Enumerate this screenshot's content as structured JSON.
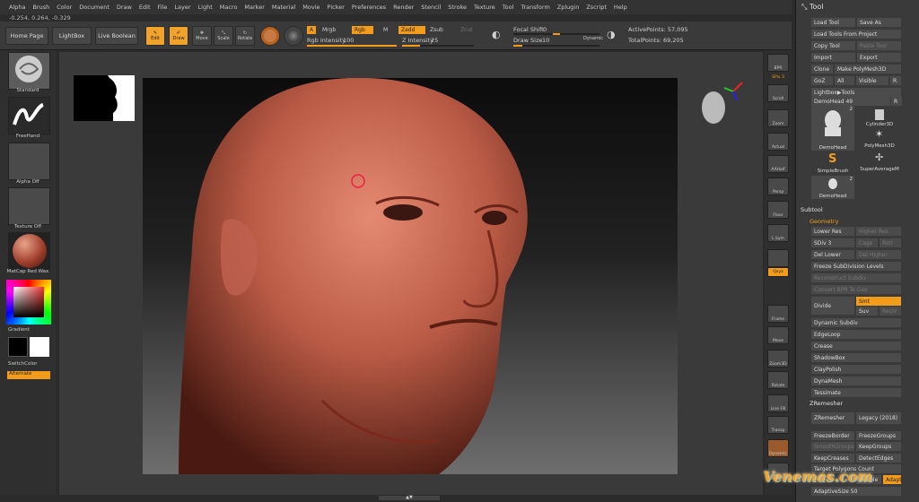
{
  "menu": [
    "Alpha",
    "Brush",
    "Color",
    "Document",
    "Draw",
    "Edit",
    "File",
    "Layer",
    "Light",
    "Macro",
    "Marker",
    "Material",
    "Movie",
    "Picker",
    "Preferences",
    "Render",
    "Stencil",
    "Stroke",
    "Texture",
    "Tool",
    "Transform",
    "Zplugin",
    "Zscript",
    "Help"
  ],
  "coords": "-0.254, 0.264, -0.329",
  "toolbar": {
    "home": "Home Page",
    "lightbox": "LightBox",
    "live_boolean": "Live Boolean",
    "edit": "Edit",
    "draw": "Draw",
    "move": "Move",
    "scale": "Scale",
    "rotate": "Rotate",
    "a": "A",
    "mrgb": "Mrgb",
    "rgb": "Rgb",
    "m": "M",
    "zadd": "Zadd",
    "zsub": "Zsub",
    "zcut": "Zcut",
    "rgb_intensity_label": "Rgb Intensity",
    "rgb_intensity_value": "100",
    "z_intensity_label": "Z Intensity",
    "z_intensity_value": "25",
    "focal_shift_label": "Focal Shift",
    "focal_shift_value": "0",
    "draw_size_label": "Draw Size",
    "draw_size_value": "10",
    "dynamic": "Dynamic",
    "active_points": "ActivePoints: 57,095",
    "total_points": "TotalPoints: 69,205",
    "rgb_intensity_level": 1.0,
    "z_intensity_level": 0.25,
    "draw_size_level": 0.1
  },
  "left": {
    "standard": "Standard",
    "freehand": "FreeHand",
    "alpha_off": "Alpha Off",
    "texture_off": "Texture Off",
    "matcap": "MatCap Red Wax",
    "gradient": "Gradient",
    "switchcolor": "SwitchColor",
    "alternate": "Alternate"
  },
  "right": {
    "bpr": "BPR",
    "spix": "SPix 3",
    "scroll": "Scroll",
    "zoom": "Zoom",
    "actual": "Actual",
    "aahalf": "AAHalf",
    "dynamic": "Dynamic",
    "persp": "Persp",
    "floor": "Floor",
    "lsym": "L.Sym",
    "xyz": "Qxyz",
    "frame": "Frame",
    "move": "Move",
    "zoom3d": "Zoom3D",
    "rotate": "Rotate",
    "line_fill": "Line Fill",
    "polyf": "PolyF",
    "transp": "Transp",
    "dynamic2": "Dynamic",
    "solo": "Solo"
  },
  "palette": {
    "title": "Tool",
    "load_tool": "Load Tool",
    "save_as": "Save As",
    "load_from_project": "Load Tools From Project",
    "copy_tool": "Copy Tool",
    "paste_tool": "Paste Tool",
    "import": "Import",
    "export": "Export",
    "clone": "Clone",
    "make_polymesh": "Make PolyMesh3D",
    "goz": "GoZ",
    "all": "All",
    "visible": "Visible",
    "r": "R",
    "lightbox_tools": "Lightbox▶Tools",
    "current_tool": "DemoHead",
    "current_tool_count": "49",
    "r2": "R",
    "tools": [
      {
        "name": "DemoHead",
        "badge": "2"
      },
      {
        "name": "Cylinder3D",
        "badge": ""
      },
      {
        "name": "SimpleBrush",
        "badge": ""
      },
      {
        "name": "PolyMesh3D",
        "badge": ""
      },
      {
        "name": "SuperAverageM",
        "badge": ""
      },
      {
        "name": "DemoHead",
        "badge": "2"
      }
    ],
    "subtool": "Subtool",
    "geometry": "Geometry",
    "lower_res": "Lower Res",
    "higher_res": "Higher Res",
    "sdiv": "SDiv 3",
    "cage": "Cage",
    "rstr": "Rstr",
    "del_lower": "Del Lower",
    "del_higher": "Del Higher",
    "freeze_subdiv": "Freeze SubDivision Levels",
    "reconstruct": "Reconstruct Subdiv",
    "convert_bpr": "Convert BPR To Geo",
    "divide": "Divide",
    "smt": "Smt",
    "suv": "Suv",
    "reuv": "ReUV",
    "dynamic_subdiv": "Dynamic Subdiv",
    "edgeloop": "EdgeLoop",
    "crease": "Crease",
    "shadowbox": "ShadowBox",
    "claypolish": "ClayPolish",
    "dynamesh": "DynaMesh",
    "tessimate": "Tessimate",
    "zremesher_head": "ZRemesher",
    "zremesher": "ZRemesher",
    "legacy": "Legacy (2018)",
    "freezeborder": "FreezeBorder",
    "freezegroups": "FreezeGroups",
    "smoothgroups": "SmoothGroups",
    "keepgroups": "KeepGroups",
    "keepcreases": "KeepCreases",
    "detectedges": "DetectEdges",
    "target_polygons": "Target Polygons Count",
    "double": "Double",
    "adapt": "Adapt",
    "adaptivesize": "AdaptiveSize 50"
  },
  "watermark": "Venemas.com"
}
